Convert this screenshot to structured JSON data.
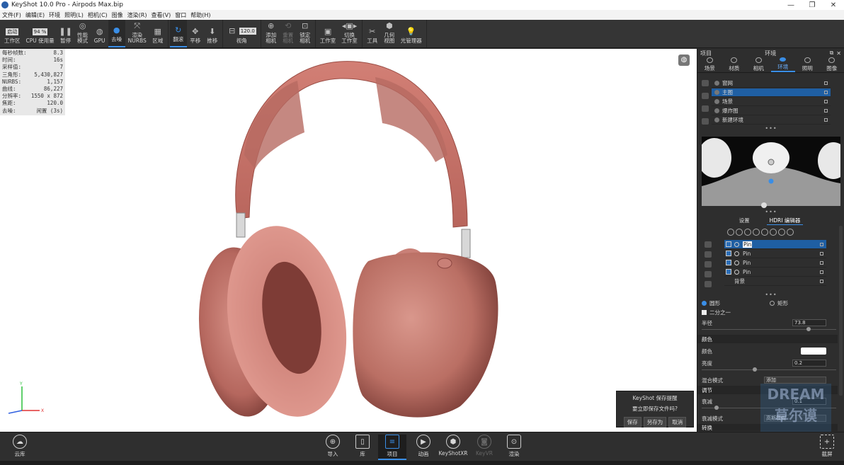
{
  "titlebar": {
    "title": "KeyShot 10.0 Pro - Airpods Max.bip",
    "min": "—",
    "max": "❐",
    "close": "✕"
  },
  "menu": [
    "文件(F)",
    "编辑(E)",
    "环境",
    "照明(L)",
    "相机(C)",
    "图像",
    "渲染(R)",
    "查看(V)",
    "窗口",
    "帮助(H)"
  ],
  "toolbar": {
    "workspace_value": "启动",
    "workspace_label": "工作区",
    "cpu_value": "94 %",
    "cpu_label": "CPU 使用量",
    "pause": "暂停",
    "perf_mode": "性能\n模式",
    "gpu": "GPU",
    "denoise": "去噪",
    "render_nurbs": "渲染\nNURBS",
    "region": "区域",
    "tumble": "翻滚",
    "pan": "平移",
    "dolly": "推移",
    "fov_value": "120.0",
    "fov_label": "视角",
    "add_camera": "添加\n相机",
    "reset_camera": "重置\n相机",
    "lock_camera": "锁定\n相机",
    "studio": "工作室",
    "switch_studio": "切换\n工作室",
    "tools": "工具",
    "geometry_view": "几何\n视图",
    "light_manager": "光管理器"
  },
  "stats": [
    {
      "k": "每秒帧数:",
      "v": "8.3"
    },
    {
      "k": "时间:",
      "v": "16s"
    },
    {
      "k": "采样值:",
      "v": "7"
    },
    {
      "k": "三角形:",
      "v": "5,430,827"
    },
    {
      "k": "NURBS:",
      "v": "1,157"
    },
    {
      "k": "曲线:",
      "v": "86,227"
    },
    {
      "k": "分辨率:",
      "v": "1550 x 872"
    },
    {
      "k": "焦距:",
      "v": "120.0"
    },
    {
      "k": "去噪:",
      "v": "闲置 (3s)"
    }
  ],
  "axes": {
    "y": "Y",
    "x": "X"
  },
  "save_dialog": {
    "title": "KeyShot 保存提醒",
    "message": "要立即保存文件吗?",
    "save": "保存",
    "save_as": "另存为",
    "cancel": "取消"
  },
  "panel": {
    "left_title": "项目",
    "center_title": "环境",
    "tabs": [
      "场景",
      "材质",
      "相机",
      "环境",
      "照明",
      "图像"
    ],
    "active_tab": 3,
    "environments": [
      {
        "label": "窗网",
        "selected": false
      },
      {
        "label": "主图",
        "selected": true
      },
      {
        "label": "场景",
        "selected": false
      },
      {
        "label": "爆炸图",
        "selected": false
      },
      {
        "label": "新建环境",
        "selected": false
      }
    ],
    "subtabs": [
      "设置",
      "HDRI 编辑器"
    ],
    "pins": [
      {
        "label": "Pin",
        "selected": true
      },
      {
        "label": "Pin",
        "selected": false
      },
      {
        "label": "Pin",
        "selected": false
      },
      {
        "label": "Pin",
        "selected": false
      }
    ],
    "background_label": "背景",
    "shape_circle": "圆形",
    "shape_rect": "矩形",
    "half": "二分之一",
    "radius_label": "半径",
    "radius_value": "73.8",
    "color_section": "颜色",
    "color_label": "颜色",
    "brightness_label": "亮度",
    "brightness_value": "0.2",
    "blend_label": "混合模式",
    "blend_value": "添加",
    "adjust_section": "调节",
    "falloff_label": "衰减",
    "falloff_value": "0.1",
    "falloff_mode_label": "衰减模式",
    "falloff_mode_value": "高斯模糊",
    "transform_section": "转换"
  },
  "bottombar": {
    "cloud": "云库",
    "import": "导入",
    "library": "库",
    "project": "项目",
    "animation": "动画",
    "keyshotxr": "KeyShotXR",
    "keyvr": "KeyVR",
    "render": "渲染",
    "screenshot": "截屏"
  },
  "watermark": "DREAM\n草尔谟",
  "colors": {
    "accent": "#3a8ee6",
    "headphone_main": "#c97a72",
    "headphone_dark": "#8a4540",
    "selection": "#1f5fa3"
  }
}
